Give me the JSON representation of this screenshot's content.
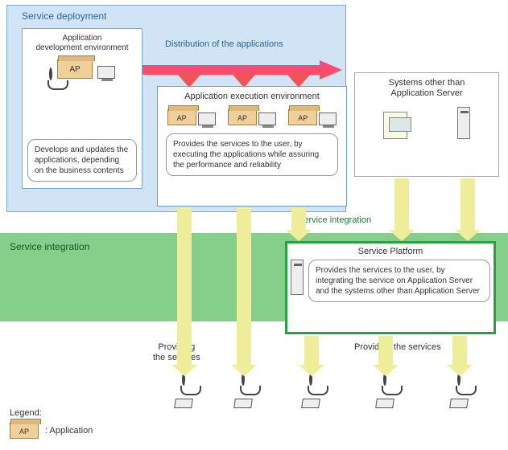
{
  "service_deployment": {
    "title": "Service deployment",
    "dev_env": {
      "title": "Application\ndevelopment environment",
      "ap_label": "AP",
      "note": "Develops and updates the applications, depending on the business contents"
    },
    "distribution_label": "Distribution of the applications",
    "exec_env": {
      "title": "Application execution environment",
      "ap_label": "AP",
      "note": "Provides the services to the user, by executing the applications while assuring the performance and reliability"
    }
  },
  "other_systems": {
    "title": "Systems other than Application Server"
  },
  "service_integration": {
    "flow_label": "Service integration",
    "title": "Service integration",
    "platform": {
      "title": "Service Platform",
      "note": "Provides the services to the user, by integrating the service on Application Server and the systems other than Application Server"
    }
  },
  "providing": {
    "label_left": "Providing the services",
    "label_right": "Providing the services"
  },
  "legend": {
    "title": "Legend:",
    "ap_label": "AP",
    "ap_meaning": ": Application"
  }
}
